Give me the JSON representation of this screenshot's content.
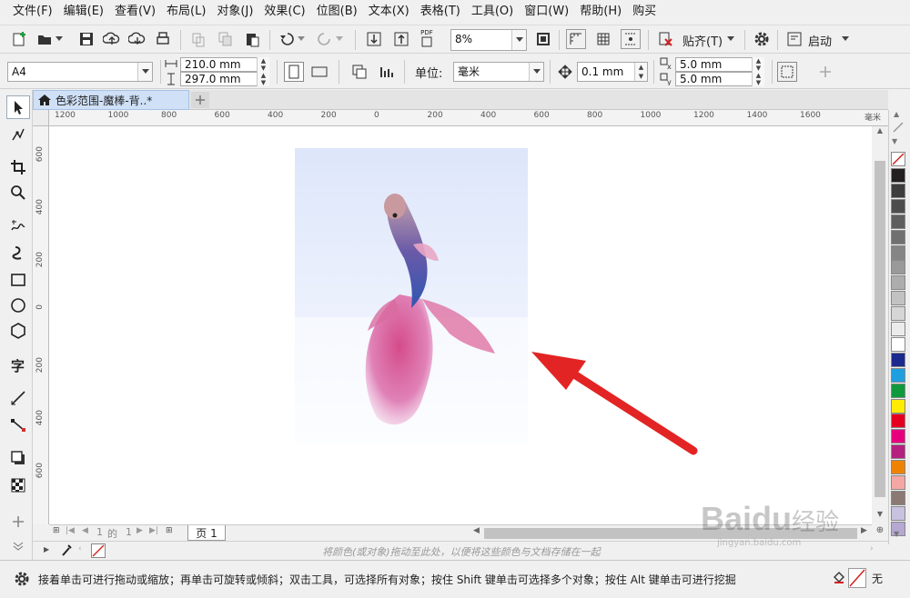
{
  "menu": [
    "文件(F)",
    "编辑(E)",
    "查看(V)",
    "布局(L)",
    "对象(J)",
    "效果(C)",
    "位图(B)",
    "文本(X)",
    "表格(T)",
    "工具(O)",
    "窗口(W)",
    "帮助(H)",
    "购买"
  ],
  "toolbar": {
    "zoom_value": "8%",
    "snap_label": "贴齐(T)",
    "launch_label": "启动",
    "pdf_label": "PDF"
  },
  "property_bar": {
    "page_size": "A4",
    "width": "210.0 mm",
    "height": "297.0 mm",
    "units_label": "单位:",
    "units_value": "毫米",
    "nudge": "0.1 mm",
    "dup_x": "5.0 mm",
    "dup_y": "5.0 mm"
  },
  "document_tab": "色彩范围-魔棒-背..*",
  "ruler": {
    "unit": "毫米",
    "h_ticks": [
      "1200",
      "1000",
      "800",
      "600",
      "400",
      "200",
      "0",
      "200",
      "400",
      "600",
      "800",
      "1000",
      "1200",
      "1400",
      "1600"
    ],
    "v_ticks": [
      "600",
      "400",
      "200",
      "0",
      "200",
      "400",
      "600"
    ]
  },
  "page_nav": {
    "current": "1",
    "of_label": "的",
    "total": "1",
    "page_tab": "页 1"
  },
  "color_bar_hint": "将颜色(或对象)拖动至此处，以便将这些颜色与文档存储在一起",
  "status_text": "接着单击可进行拖动或缩放；再单击可旋转或倾斜；双击工具，可选择所有对象；按住 Shift 键单击可选择多个对象；按住 Alt 键单击可进行挖掘",
  "fill_none_label": "无",
  "watermark": {
    "brand": "Bai",
    "brand2": "du",
    "suffix": "经验",
    "url": "jingyan.baidu.com"
  },
  "palette_colors": [
    "#231f20",
    "#3d3d3d",
    "#4d4d4d",
    "#5e5e5e",
    "#707070",
    "#858585",
    "#999999",
    "#adadad",
    "#c2c2c2",
    "#d6d6d6",
    "#ebebeb",
    "#ffffff",
    "#1b2a8c",
    "#1e9fe0",
    "#0e9a3c",
    "#ffec00",
    "#e5001f",
    "#e6007e",
    "#b5207f",
    "#ef8200",
    "#f4a7a3",
    "#8a7a73",
    "#c8c2e0",
    "#b7a7d3"
  ],
  "colors": {
    "accent": "#2a6fd6",
    "tab_bg": "#cfe0f7",
    "arrow": "#e32424"
  }
}
